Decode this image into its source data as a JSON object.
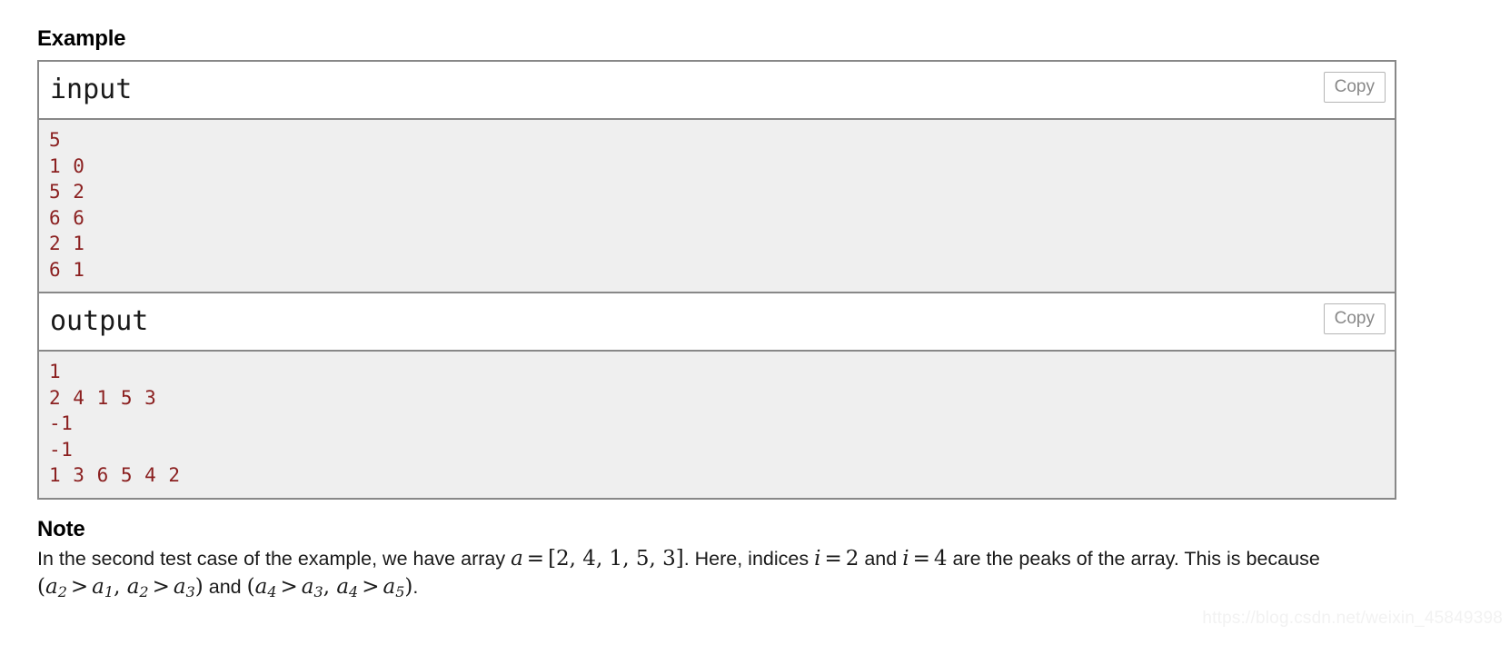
{
  "example": {
    "heading": "Example",
    "input_block": {
      "title": "input",
      "copy_label": "Copy",
      "content": "5\n1 0\n5 2\n6 6\n2 1\n6 1"
    },
    "output_block": {
      "title": "output",
      "copy_label": "Copy",
      "content": "1\n2 4 1 5 3\n-1\n-1\n1 3 6 5 4 2"
    }
  },
  "note": {
    "heading": "Note",
    "line1_pre": "In the second test case of the example, we have array ",
    "math_a": "a",
    "math_eq1": "=",
    "math_array": "[2, 4, 1, 5, 3]",
    "line1_mid": ". Here, indices ",
    "math_i1": "i",
    "math_eq2": "=",
    "math_2": "2",
    "line1_and": " and ",
    "math_i2": "i",
    "math_eq3": "=",
    "math_4": "4",
    "line1_post": " are the peaks of the array. This is because ",
    "ineq1": {
      "open": "(",
      "a1": "a",
      "s1": "2",
      "op1": ">",
      "b1": "a",
      "t1": "1",
      "comma": ", ",
      "a2": "a",
      "s2": "2",
      "op2": ">",
      "b2": "a",
      "t2": "3",
      "close": ")"
    },
    "between": " and ",
    "ineq2": {
      "open": "(",
      "a1": "a",
      "s1": "4",
      "op1": ">",
      "b1": "a",
      "t1": "3",
      "comma": ", ",
      "a2": "a",
      "s2": "4",
      "op2": ">",
      "b2": "a",
      "t2": "5",
      "close": ")"
    },
    "period": "."
  },
  "watermark": {
    "text": "https://blog.csdn.net/weixin_45849398"
  },
  "colors": {
    "sample_text": "#8b2020",
    "sample_bg": "#efefef",
    "border": "#888888",
    "copy_text": "#888888"
  }
}
